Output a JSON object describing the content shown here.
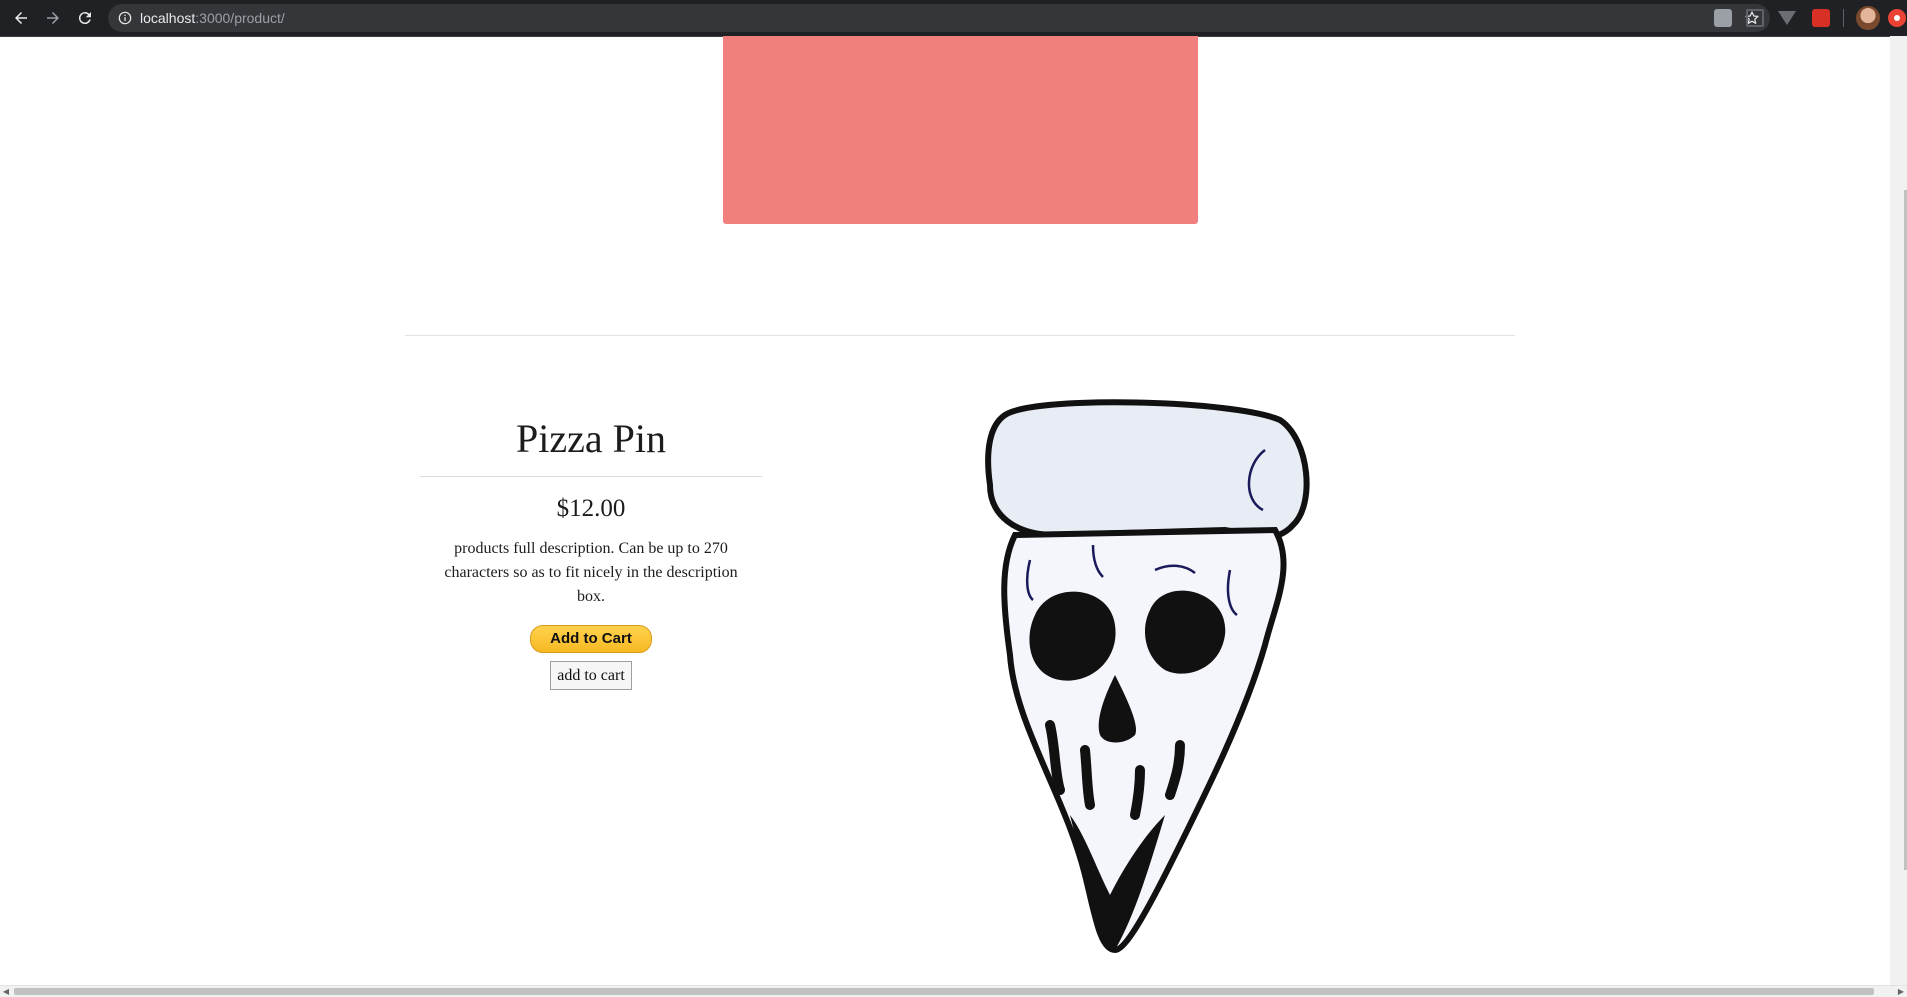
{
  "browser": {
    "url_host": "localhost",
    "url_path": ":3000/product/"
  },
  "product": {
    "title": "Pizza Pin",
    "price": "$12.00",
    "description": "products full description. Can be up to 270 characters so as to fit nicely in the description box.",
    "paypal_label": "Add to Cart",
    "add_label": "add to cart"
  },
  "colors": {
    "banner": "#f07f7e",
    "paypal": "#f7b923"
  },
  "icons": [
    "back-arrow-icon",
    "forward-arrow-icon",
    "reload-icon",
    "info-icon",
    "star-icon",
    "skull-pizza-pin-image"
  ]
}
